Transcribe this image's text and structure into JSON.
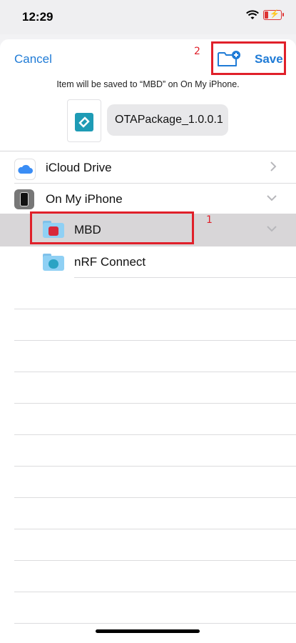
{
  "status_bar": {
    "time": "12:29"
  },
  "header": {
    "cancel_label": "Cancel",
    "save_label": "Save",
    "info_text": "Item will be saved to “MBD” on On My iPhone.",
    "filename": "OTAPackage_1.0.0.1"
  },
  "locations": [
    {
      "label": "iCloud Drive",
      "icon": "icloud-icon"
    },
    {
      "label": "On My iPhone",
      "icon": "iphone-icon"
    },
    {
      "label": "MBD",
      "icon": "folder-icon",
      "selected": true
    },
    {
      "label": "nRF Connect",
      "icon": "folder-icon"
    }
  ],
  "annotations": {
    "first": "1",
    "second": "2"
  },
  "colors": {
    "accent": "#1f7bd6",
    "annotation": "#e0202a",
    "selected_row": "#d8d6d8"
  }
}
